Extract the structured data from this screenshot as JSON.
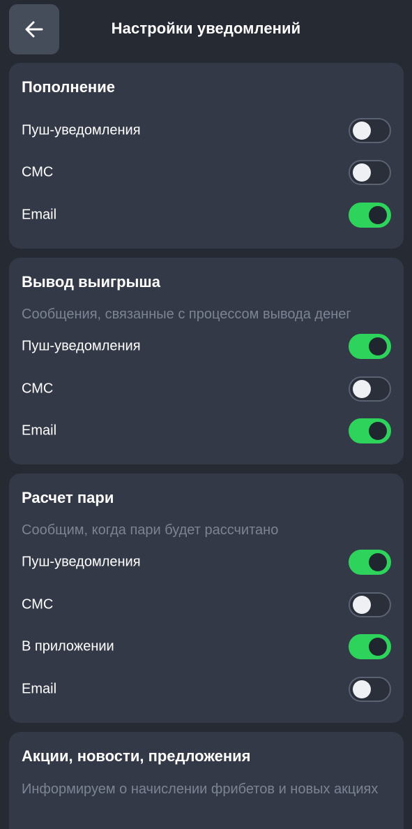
{
  "header": {
    "title": "Настройки уведомлений",
    "back_icon": "arrow-left-icon"
  },
  "sections": [
    {
      "title": "Пополнение",
      "description": "",
      "rows": [
        {
          "label": "Пуш-уведомления",
          "enabled": false
        },
        {
          "label": "СМС",
          "enabled": false
        },
        {
          "label": "Email",
          "enabled": true
        }
      ]
    },
    {
      "title": "Вывод выигрыша",
      "description": "Сообщения, связанные с процессом вывода денег",
      "rows": [
        {
          "label": "Пуш-уведомления",
          "enabled": true
        },
        {
          "label": "СМС",
          "enabled": false
        },
        {
          "label": "Email",
          "enabled": true
        }
      ]
    },
    {
      "title": "Расчет пари",
      "description": "Сообщим, когда пари будет рассчитано",
      "rows": [
        {
          "label": "Пуш-уведомления",
          "enabled": true
        },
        {
          "label": "СМС",
          "enabled": false
        },
        {
          "label": "В приложении",
          "enabled": true
        },
        {
          "label": "Email",
          "enabled": false
        }
      ]
    },
    {
      "title": "Акции, новости, предложения",
      "description": "Информируем о начислении фрибетов и новых акциях",
      "rows": []
    }
  ],
  "colors": {
    "background": "#252a33",
    "card": "#333947",
    "toggle_on": "#2ed35b",
    "toggle_off_border": "#5b6372",
    "muted_text": "#7c8493"
  }
}
